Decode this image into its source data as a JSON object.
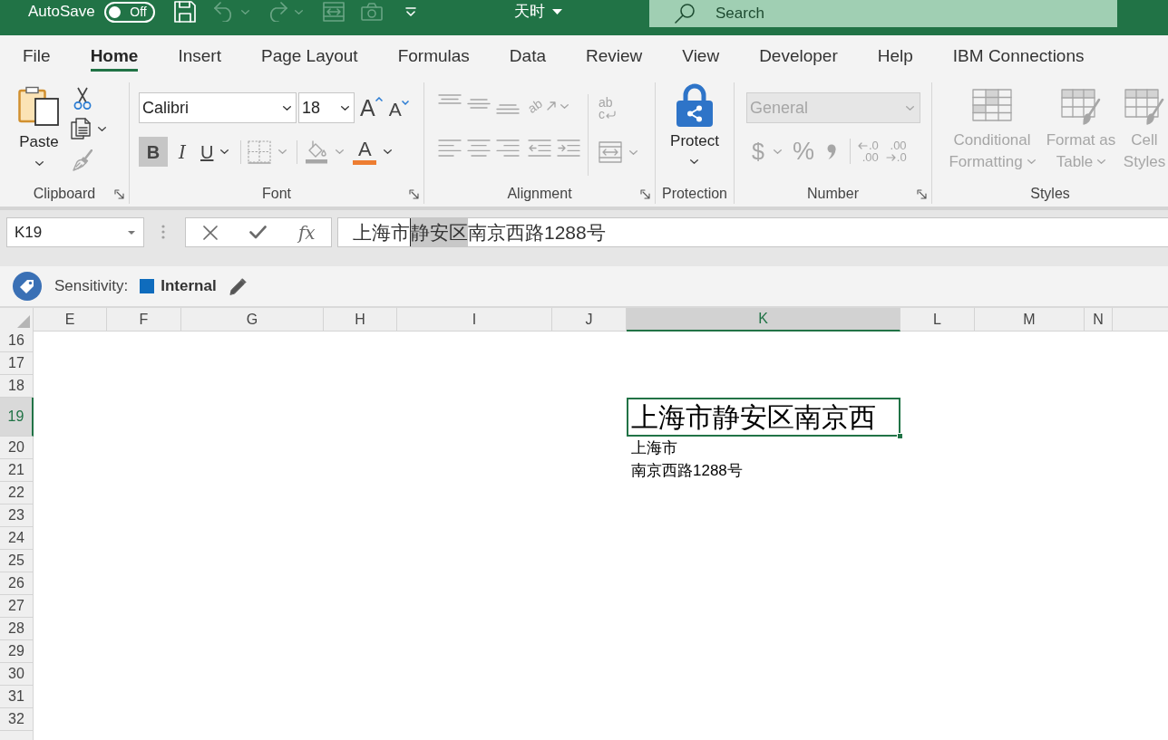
{
  "title_bar": {
    "autosave": {
      "label": "AutoSave",
      "state_label": "Off",
      "on": false
    },
    "quick_access": [
      {
        "kind": "save",
        "disabled": false
      },
      {
        "kind": "undo",
        "disabled": true
      },
      {
        "kind": "redo",
        "disabled": true
      },
      {
        "kind": "form",
        "disabled": true
      },
      {
        "kind": "camera",
        "disabled": true
      }
    ],
    "document_title": "天时",
    "search": {
      "placeholder": "Search"
    }
  },
  "tabs": [
    {
      "label": "File",
      "selected": false
    },
    {
      "label": "Home",
      "selected": true
    },
    {
      "label": "Insert",
      "selected": false
    },
    {
      "label": "Page Layout",
      "selected": false
    },
    {
      "label": "Formulas",
      "selected": false
    },
    {
      "label": "Data",
      "selected": false
    },
    {
      "label": "Review",
      "selected": false
    },
    {
      "label": "View",
      "selected": false
    },
    {
      "label": "Developer",
      "selected": false
    },
    {
      "label": "Help",
      "selected": false
    },
    {
      "label": "IBM Connections",
      "selected": false
    }
  ],
  "ribbon": {
    "clipboard": {
      "label": "Clipboard",
      "launcher": true,
      "paste": "Paste",
      "tools": [
        {
          "kind": "cut",
          "disabled": false
        },
        {
          "kind": "copy",
          "disabled": false
        },
        {
          "kind": "format_painter",
          "disabled": true
        }
      ]
    },
    "font": {
      "label": "Font",
      "launcher": true,
      "font_name": "Calibri",
      "font_size": "18",
      "size_buttons": [
        {
          "kind": "grow",
          "label": "A"
        },
        {
          "kind": "shrink",
          "label": "A"
        }
      ],
      "styles": [
        {
          "kind": "bold",
          "label": "B",
          "on": true
        },
        {
          "kind": "italic",
          "label": "I",
          "on": false
        },
        {
          "kind": "underline",
          "label": "U",
          "on": false
        }
      ],
      "borders": {
        "disabled": true
      },
      "fill_color": {
        "disabled": true
      },
      "font_color": {
        "label": "A",
        "disabled": false
      }
    },
    "alignment": {
      "label": "Alignment",
      "launcher": true,
      "disabled": true,
      "orientation": "ab",
      "wrap_text": [
        "ab",
        "c"
      ]
    },
    "protection": {
      "label": "Protection",
      "launcher": false,
      "button": "Protect"
    },
    "number": {
      "label": "Number",
      "launcher": true,
      "disabled": true,
      "format": "General",
      "currency": "$",
      "percent": "%",
      "decimals": [
        {
          "kind": "decrease",
          "lines": [
            ".0",
            ".00"
          ]
        },
        {
          "kind": "increase",
          "lines": [
            ".00",
            ".0"
          ]
        }
      ]
    },
    "styles": {
      "label": "Styles",
      "launcher": false,
      "disabled": true,
      "buttons": [
        {
          "kind": "conditional",
          "label": "Conditional Formatting",
          "caret": true
        },
        {
          "kind": "table",
          "label": "Format as Table",
          "caret": true
        },
        {
          "kind": "cell",
          "label": "Cell Styles",
          "caret": false
        }
      ]
    }
  },
  "formula_bar": {
    "name_box": "K19",
    "function_label": "fx",
    "segments": [
      {
        "text": "上海市",
        "selected": false
      },
      {
        "text": "静安区",
        "selected": true
      },
      {
        "text": "南京西路1288号",
        "selected": false
      }
    ]
  },
  "sensitivity": {
    "label": "Sensitivity:",
    "value": "Internal"
  },
  "sheet": {
    "columns": [
      {
        "label": "E",
        "selected": false
      },
      {
        "label": "F",
        "selected": false
      },
      {
        "label": "G",
        "selected": false
      },
      {
        "label": "H",
        "selected": false
      },
      {
        "label": "I",
        "selected": false
      },
      {
        "label": "J",
        "selected": false
      },
      {
        "label": "K",
        "selected": true
      },
      {
        "label": "L",
        "selected": false
      },
      {
        "label": "M",
        "selected": false
      },
      {
        "label": "N",
        "selected": false
      }
    ],
    "rows": [
      {
        "header": "16",
        "selected": false
      },
      {
        "header": "17",
        "selected": false
      },
      {
        "header": "18",
        "selected": false
      },
      {
        "header": "19",
        "selected": true,
        "cell": "上海市静安区南京西"
      },
      {
        "header": "20",
        "selected": false,
        "cell": "上海市"
      },
      {
        "header": "21",
        "selected": false,
        "cell": "南京西路1288号"
      },
      {
        "header": "22",
        "selected": false
      },
      {
        "header": "23",
        "selected": false
      },
      {
        "header": "24",
        "selected": false
      },
      {
        "header": "25",
        "selected": false
      },
      {
        "header": "26",
        "selected": false
      },
      {
        "header": "27",
        "selected": false
      },
      {
        "header": "28",
        "selected": false
      },
      {
        "header": "29",
        "selected": false
      },
      {
        "header": "30",
        "selected": false
      },
      {
        "header": "31",
        "selected": false
      },
      {
        "header": "32",
        "selected": false
      }
    ]
  }
}
